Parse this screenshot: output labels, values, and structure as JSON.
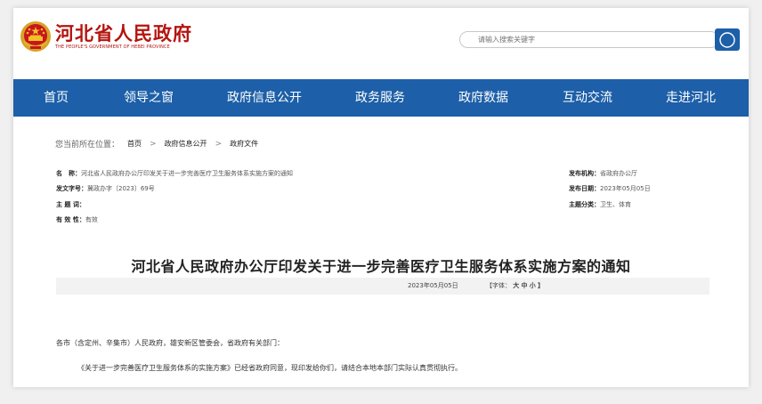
{
  "site": {
    "title": "河北省人民政府",
    "subtitle": "THE PEOPLE'S GOVERNMENT OF HEBEI PROVINCE"
  },
  "search": {
    "placeholder": "请输入搜索关键字"
  },
  "nav": [
    "首页",
    "领导之窗",
    "政府信息公开",
    "政务服务",
    "政府数据",
    "互动交流",
    "走进河北"
  ],
  "breadcrumb": {
    "label": "您当前所在位置：",
    "items": [
      "首页",
      "政府信息公开",
      "政府文件"
    ],
    "separator": ">"
  },
  "meta": {
    "name_label": "名　称：",
    "name_value": "河北省人民政府办公厅印发关于进一步完善医疗卫生服务体系实施方案的通知",
    "doc_no_label": "发文字号：",
    "doc_no_value": "冀政办字〔2023〕69号",
    "keywords_label": "主 题 词：",
    "keywords_value": "",
    "validity_label": "有 效 性：",
    "validity_value": "有效",
    "org_label": "发布机构：",
    "org_value": "省政府办公厅",
    "date_label": "发布日期：",
    "date_value": "2023年05月05日",
    "category_label": "主题分类：",
    "category_value": "卫生、体育"
  },
  "article": {
    "title": "河北省人民政府办公厅印发关于进一步完善医疗卫生服务体系实施方案的通知",
    "date": "2023年05月05日",
    "font_label": "【字体：",
    "font_large": "大",
    "font_medium": "中",
    "font_small": "小",
    "font_close": "】",
    "para1": "各市（含定州、辛集市）人民政府，雄安新区管委会，省政府有关部门：",
    "para2": "《关于进一步完善医疗卫生服务体系的实施方案》已经省政府同意，现印发给你们，请结合本地本部门实际认真贯彻执行。"
  },
  "colors": {
    "brand_red": "#b4140f",
    "nav_blue": "#1d5fa8"
  }
}
